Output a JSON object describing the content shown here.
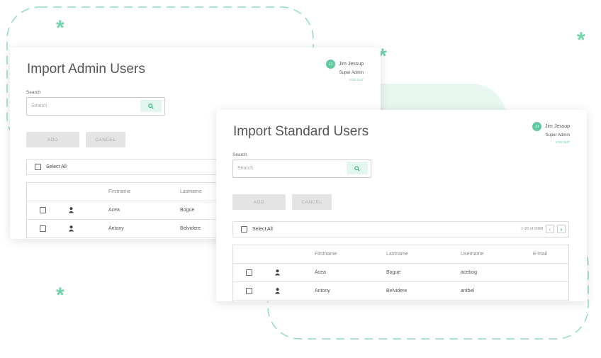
{
  "cards": [
    {
      "title": "Import Admin Users",
      "user": {
        "initials": "JJ",
        "name": "Jim Jessup",
        "role": "Super Admin",
        "logout": "LOG OUT"
      },
      "search": {
        "label": "Search",
        "placeholder": "Search"
      },
      "add_label": "ADD",
      "cancel_label": "CANCEL",
      "select_all": "Select All",
      "columns": [
        "Firstname",
        "Lastname"
      ],
      "rows": [
        [
          "Acea",
          "Bogue"
        ],
        [
          "Antony",
          "Belvidere"
        ]
      ]
    },
    {
      "title": "Import Standard Users",
      "user": {
        "initials": "JJ",
        "name": "Jim Jessup",
        "role": "Super Admin",
        "logout": "LOG OUT"
      },
      "search": {
        "label": "Search",
        "placeholder": "Search"
      },
      "add_label": "ADD",
      "cancel_label": "CANCEL",
      "select_all": "Select All",
      "pagination": "1-20 of 2090",
      "columns": [
        "Firstname",
        "Lastname",
        "Username",
        "E-mail"
      ],
      "rows": [
        [
          "Acea",
          "Bogue",
          "acebog",
          ""
        ],
        [
          "Antony",
          "Belvidere",
          "antbel",
          ""
        ]
      ]
    }
  ],
  "colors": {
    "accent": "#5fc9a0"
  }
}
